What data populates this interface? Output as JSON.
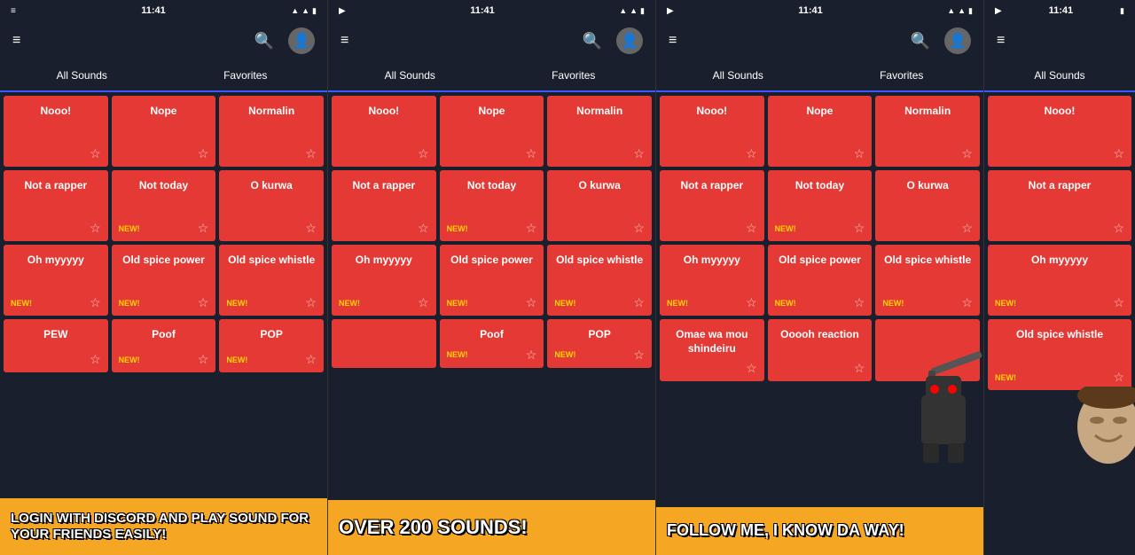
{
  "panels": [
    {
      "id": "panel1",
      "statusTime": "11:41",
      "tabs": [
        "All Sounds",
        "Favorites"
      ],
      "activeTab": 0,
      "sounds": [
        {
          "name": "Nooo!",
          "new": false
        },
        {
          "name": "Nope",
          "new": false
        },
        {
          "name": "Normalin",
          "new": false
        },
        {
          "name": "Not a rapper",
          "new": false
        },
        {
          "name": "Not today",
          "new": true
        },
        {
          "name": "O kurwa",
          "new": false
        },
        {
          "name": "Oh myyyyy",
          "new": true
        },
        {
          "name": "Old spice power",
          "new": true
        },
        {
          "name": "Old spice whistle",
          "new": true
        },
        {
          "name": "PEW",
          "new": false
        },
        {
          "name": "Poof",
          "new": true
        },
        {
          "name": "POP",
          "new": true
        }
      ],
      "banner": {
        "text": "LOGIN WITH DISCORD AND PLAY SOUND FOR YOUR FRIENDS EASILY!",
        "type": "discord"
      }
    },
    {
      "id": "panel2",
      "statusTime": "11:41",
      "tabs": [
        "All Sounds",
        "Favorites"
      ],
      "activeTab": 0,
      "sounds": [
        {
          "name": "Nooo!",
          "new": false
        },
        {
          "name": "Nope",
          "new": false
        },
        {
          "name": "Normalin",
          "new": false
        },
        {
          "name": "Not a rapper",
          "new": false
        },
        {
          "name": "Not today",
          "new": true
        },
        {
          "name": "O kurwa",
          "new": false
        },
        {
          "name": "Oh myyyyy",
          "new": true
        },
        {
          "name": "Old spice power",
          "new": true
        },
        {
          "name": "Old spice whistle",
          "new": true
        },
        {
          "name": "",
          "new": false
        },
        {
          "name": "Poof",
          "new": true
        },
        {
          "name": "POP",
          "new": true
        }
      ],
      "banner": {
        "text": "OVER 200 SOUNDS!",
        "type": "sounds"
      }
    },
    {
      "id": "panel3",
      "statusTime": "11:41",
      "tabs": [
        "All Sounds",
        "Favorites"
      ],
      "activeTab": 0,
      "sounds": [
        {
          "name": "Nooo!",
          "new": false
        },
        {
          "name": "Nope",
          "new": false
        },
        {
          "name": "Normalin",
          "new": false
        },
        {
          "name": "Not a rapper",
          "new": false
        },
        {
          "name": "Not today",
          "new": true
        },
        {
          "name": "O kurwa",
          "new": false
        },
        {
          "name": "Oh myyyyy",
          "new": true
        },
        {
          "name": "Old spice power",
          "new": true
        },
        {
          "name": "Old spice whistle",
          "new": true
        },
        {
          "name": "Omae wa mou shindeiru",
          "new": false
        },
        {
          "name": "Ooooh reaction",
          "new": false
        }
      ],
      "banner": {
        "text": "FOLLOW ME, I KNOW DA WAY!",
        "type": "follow"
      }
    },
    {
      "id": "panel4",
      "statusTime": "11:41",
      "tabs": [
        "All Sounds"
      ],
      "activeTab": 0,
      "sounds": [
        {
          "name": "Nooo!",
          "new": false
        },
        {
          "name": "Not a rapper",
          "new": false
        },
        {
          "name": "Oh myyyyy",
          "new": true
        },
        {
          "name": "Old spice\nwhistle",
          "new": true
        }
      ],
      "banner": null
    }
  ],
  "icons": {
    "menu": "≡",
    "search": "🔍",
    "back": "◀",
    "home": "⬤",
    "stop": "■",
    "star": "☆",
    "starFilled": "★",
    "signal": "▲",
    "wifi": "▲",
    "battery": "▮"
  }
}
